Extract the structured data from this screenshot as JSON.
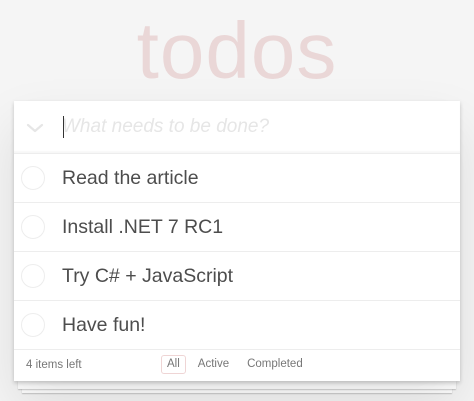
{
  "app": {
    "title": "todos"
  },
  "new_todo": {
    "placeholder": "What needs to be done?",
    "value": ""
  },
  "todos": [
    {
      "label": "Read the article",
      "completed": false
    },
    {
      "label": "Install .NET 7 RC1",
      "completed": false
    },
    {
      "label": "Try C# + JavaScript",
      "completed": false
    },
    {
      "label": "Have fun!",
      "completed": false
    }
  ],
  "footer": {
    "count_text": "4 items left",
    "filters": [
      {
        "label": "All",
        "selected": true
      },
      {
        "label": "Active",
        "selected": false
      },
      {
        "label": "Completed",
        "selected": false
      }
    ]
  },
  "colors": {
    "title": "#efd5d5",
    "text": "#4d4d4d",
    "selected_filter_border": "#efd5d5"
  },
  "icons": {
    "toggle_all": "chevron-down-icon"
  }
}
